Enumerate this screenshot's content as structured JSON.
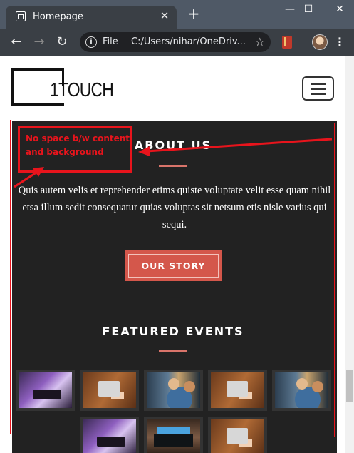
{
  "browser": {
    "tab_title": "Homepage",
    "tab_close": "✕",
    "new_tab": "+",
    "window_controls": {
      "minimize": "—",
      "maximize": "☐",
      "close": "✕"
    },
    "nav": {
      "back": "←",
      "forward": "→",
      "reload": "↻"
    },
    "address": {
      "scheme": "File",
      "url": "C:/Users/nihar/OneDriv...",
      "info": "i",
      "star": "☆"
    },
    "menu": "⋮"
  },
  "site": {
    "logo_text": "1TOUCH",
    "about": {
      "title": "ABOUT US",
      "text": "Quis autem velis et reprehender etims quiste voluptate velit esse quam nihil etsa illum sedit consequatur quias voluptas sit netsum etis nisle varius qui sequi.",
      "button": "OUR STORY"
    },
    "events": {
      "title": "FEATURED EVENTS",
      "thumbnails": [
        {
          "subject": "purple-studio"
        },
        {
          "subject": "laptop-on-desk"
        },
        {
          "subject": "people-at-computer"
        },
        {
          "subject": "laptop-on-desk"
        },
        {
          "subject": "people-at-computer"
        },
        {
          "subject": "purple-studio"
        },
        {
          "subject": "dark-desk-monitors"
        },
        {
          "subject": "laptop-on-desk"
        }
      ]
    }
  },
  "annotation": {
    "text": "No space b/w content and background",
    "color": "#e8141c"
  },
  "colors": {
    "accent": "#d4574b",
    "dark_bg": "#222222",
    "chrome_tab": "#3a3f45"
  }
}
